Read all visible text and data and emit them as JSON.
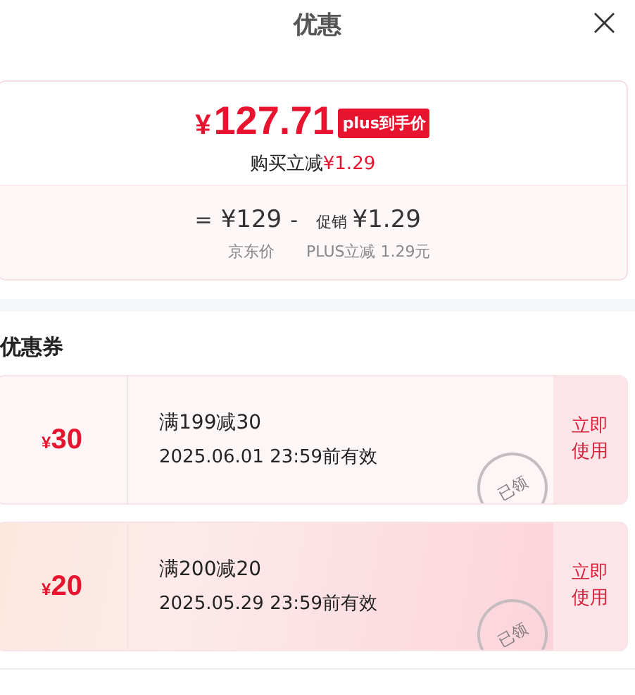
{
  "header": {
    "title": "优惠",
    "close": "×"
  },
  "price_card": {
    "currency": "¥",
    "amount": "127.71",
    "badge": "plus到手价",
    "saving_label": "购买立减",
    "saving_value": "¥1.29",
    "formula": [
      {
        "kind": "op",
        "text": "="
      },
      {
        "kind": "value",
        "text": "¥129",
        "caption": "京东价"
      },
      {
        "kind": "op",
        "text": "-"
      },
      {
        "kind": "value",
        "prefix": "促销",
        "text": "¥1.29",
        "caption": "PLUS立减 1.29元"
      }
    ]
  },
  "coupons_section": {
    "title": "优惠券",
    "coupons": [
      {
        "currency": "¥",
        "amount": "30",
        "rule": "满199减30",
        "validity": "2025.06.01 23:59前有效",
        "stamp": "已领",
        "action": "立即使用",
        "highlighted": false
      },
      {
        "currency": "¥",
        "amount": "20",
        "rule": "满200减20",
        "validity": "2025.05.29 23:59前有效",
        "stamp": "已领",
        "action": "立即使用",
        "highlighted": true
      }
    ]
  }
}
